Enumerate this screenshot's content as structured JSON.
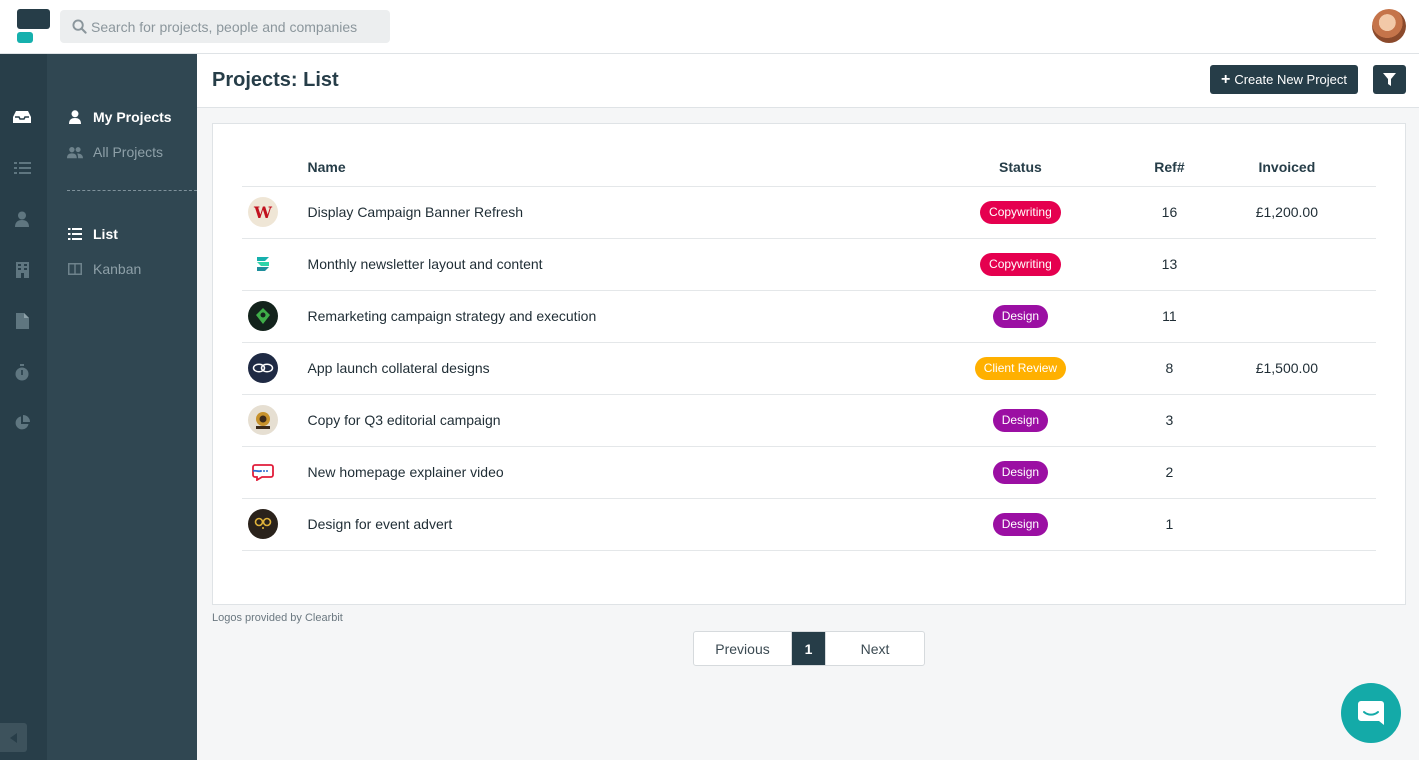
{
  "topbar": {
    "search_placeholder": "Search for projects, people and companies"
  },
  "rail": {
    "icons": [
      "inbox-icon",
      "list-icon",
      "person-icon",
      "building-icon",
      "document-icon",
      "stopwatch-icon",
      "pie-chart-icon"
    ]
  },
  "subnav": {
    "my_projects": "My Projects",
    "all_projects": "All Projects",
    "list": "List",
    "kanban": "Kanban"
  },
  "header": {
    "title": "Projects: List",
    "create_label": "Create New Project"
  },
  "table": {
    "columns": {
      "name": "Name",
      "status": "Status",
      "ref": "Ref#",
      "invoiced": "Invoiced"
    },
    "rows": [
      {
        "name": "Display Campaign Banner Refresh",
        "status": "Copywriting",
        "ref": "16",
        "invoiced": "£1,200.00",
        "status_color": "#e5004f"
      },
      {
        "name": "Monthly newsletter layout and content",
        "status": "Copywriting",
        "ref": "13",
        "invoiced": "",
        "status_color": "#e5004f"
      },
      {
        "name": "Remarketing campaign strategy and execution",
        "status": "Design",
        "ref": "11",
        "invoiced": "",
        "status_color": "#9b0fa3"
      },
      {
        "name": "App launch collateral designs",
        "status": "Client Review",
        "ref": "8",
        "invoiced": "£1,500.00",
        "status_color": "#ffb000"
      },
      {
        "name": "Copy for Q3 editorial campaign",
        "status": "Design",
        "ref": "3",
        "invoiced": "",
        "status_color": "#9b0fa3"
      },
      {
        "name": "New homepage explainer video",
        "status": "Design",
        "ref": "2",
        "invoiced": "",
        "status_color": "#9b0fa3"
      },
      {
        "name": "Design for event advert",
        "status": "Design",
        "ref": "1",
        "invoiced": "",
        "status_color": "#9b0fa3"
      }
    ]
  },
  "footer": {
    "clearbit": "Logos provided by Clearbit"
  },
  "pagination": {
    "previous": "Previous",
    "current": "1",
    "next": "Next"
  },
  "colors": {
    "brand_dark": "#263d48",
    "brand_teal": "#16b0ad",
    "copywriting": "#e5004f",
    "design": "#9b0fa3",
    "client_review": "#ffb000"
  }
}
